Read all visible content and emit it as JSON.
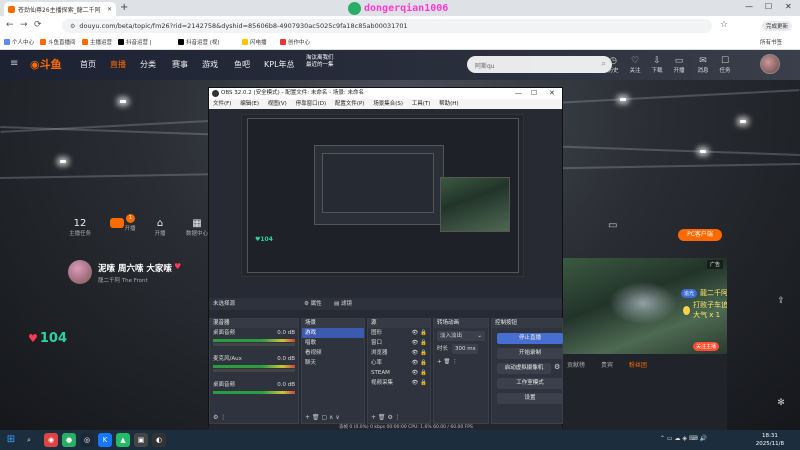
{
  "browser": {
    "tab_title": "苍劲仙尊26主播探索_龍二千阿",
    "url": "douyu.com/beta/topic/fm26?rid=2142758&dyshid=85606b8-4907930ac5025c9fa18c85ab00031701",
    "bookmarks": [
      "个人中心",
      "斗鱼直播间",
      "主播运营",
      "抖音运营 | ",
      "抖音运营 (视)",
      "闪电播",
      "创作中心"
    ],
    "all_bookmarks": "所有书签",
    "update_label": "完成更新"
  },
  "watermark": {
    "text": "dongerqian1006"
  },
  "douyu": {
    "nav": [
      "首页",
      "直播",
      "分类",
      "赛事",
      "游戏",
      "鱼吧",
      "KPL年总"
    ],
    "promo_line1": "淘汰离我们",
    "promo_line2": "最近的一集",
    "search_placeholder": "阿斯qu",
    "header_icons": [
      "历史",
      "关注",
      "下载",
      "开播",
      "消息",
      "任务"
    ],
    "stats": [
      {
        "value": "12",
        "label": "主播任务"
      },
      {
        "value": "",
        "label": "开播"
      },
      {
        "value": "",
        "label": "开播"
      },
      {
        "value": "",
        "label": "数据中心"
      }
    ],
    "task_badge": "1",
    "streamer_name": "泥嗦 周六嗦 大家嗦",
    "streamer_sub": "龍二千阿   The Front",
    "heart_count": "104",
    "pc_client": "PC客户端",
    "ad_tag": "广告",
    "danmu": [
      {
        "badge": "追光",
        "text": "龍二千阿 来了"
      },
      {
        "badge": "",
        "text": "打败子车追moon大哥 送出 大气 x 1"
      }
    ],
    "chat_tabs": [
      "贡献榜",
      "贵宾",
      "粉丝团"
    ],
    "follow_label": "关注主播"
  },
  "obs": {
    "window_title": "OBS 32.0.2 (安全模式) - 配置文件: 未命名 - 场景: 未命名",
    "menu": [
      "文件(F)",
      "编辑(E)",
      "视图(V)",
      "停靠窗口(D)",
      "配置文件(P)",
      "场景集合(S)",
      "工具(T)",
      "帮助(H)"
    ],
    "source_status": "未选择源",
    "properties_label": "属性",
    "filters_label": "滤镜",
    "mixer": {
      "header": "混音器",
      "channels": [
        {
          "name": "桌面音频",
          "db": "0.0 dB"
        },
        {
          "name": "麦克风/Aux",
          "db": "0.0 dB"
        },
        {
          "name": "桌面音频",
          "db": "0.0 dB"
        }
      ]
    },
    "scenes": {
      "header": "场景",
      "items": [
        "游戏",
        "唱歌",
        "看视频",
        "聊天"
      ]
    },
    "sources": {
      "header": "源",
      "items": [
        "图形",
        "窗口",
        "浏览器",
        "心率",
        "STEAM",
        "视频采集"
      ]
    },
    "transitions": {
      "header": "转场动画",
      "type": "淡入淡出",
      "duration_label": "时长",
      "duration": "300 ms"
    },
    "controls": {
      "header": "控制按钮",
      "buttons": [
        "停止直播",
        "开始录制",
        "启动虚拟摄像机",
        "工作室模式",
        "设置"
      ]
    },
    "status": "丢帧 0 (0.0%)   0 kbps   00:00:00   CPU: 1.6%   60.00 / 60.00 FPS"
  },
  "taskbar": {
    "time": "18:31",
    "date": "2025/11/8"
  }
}
